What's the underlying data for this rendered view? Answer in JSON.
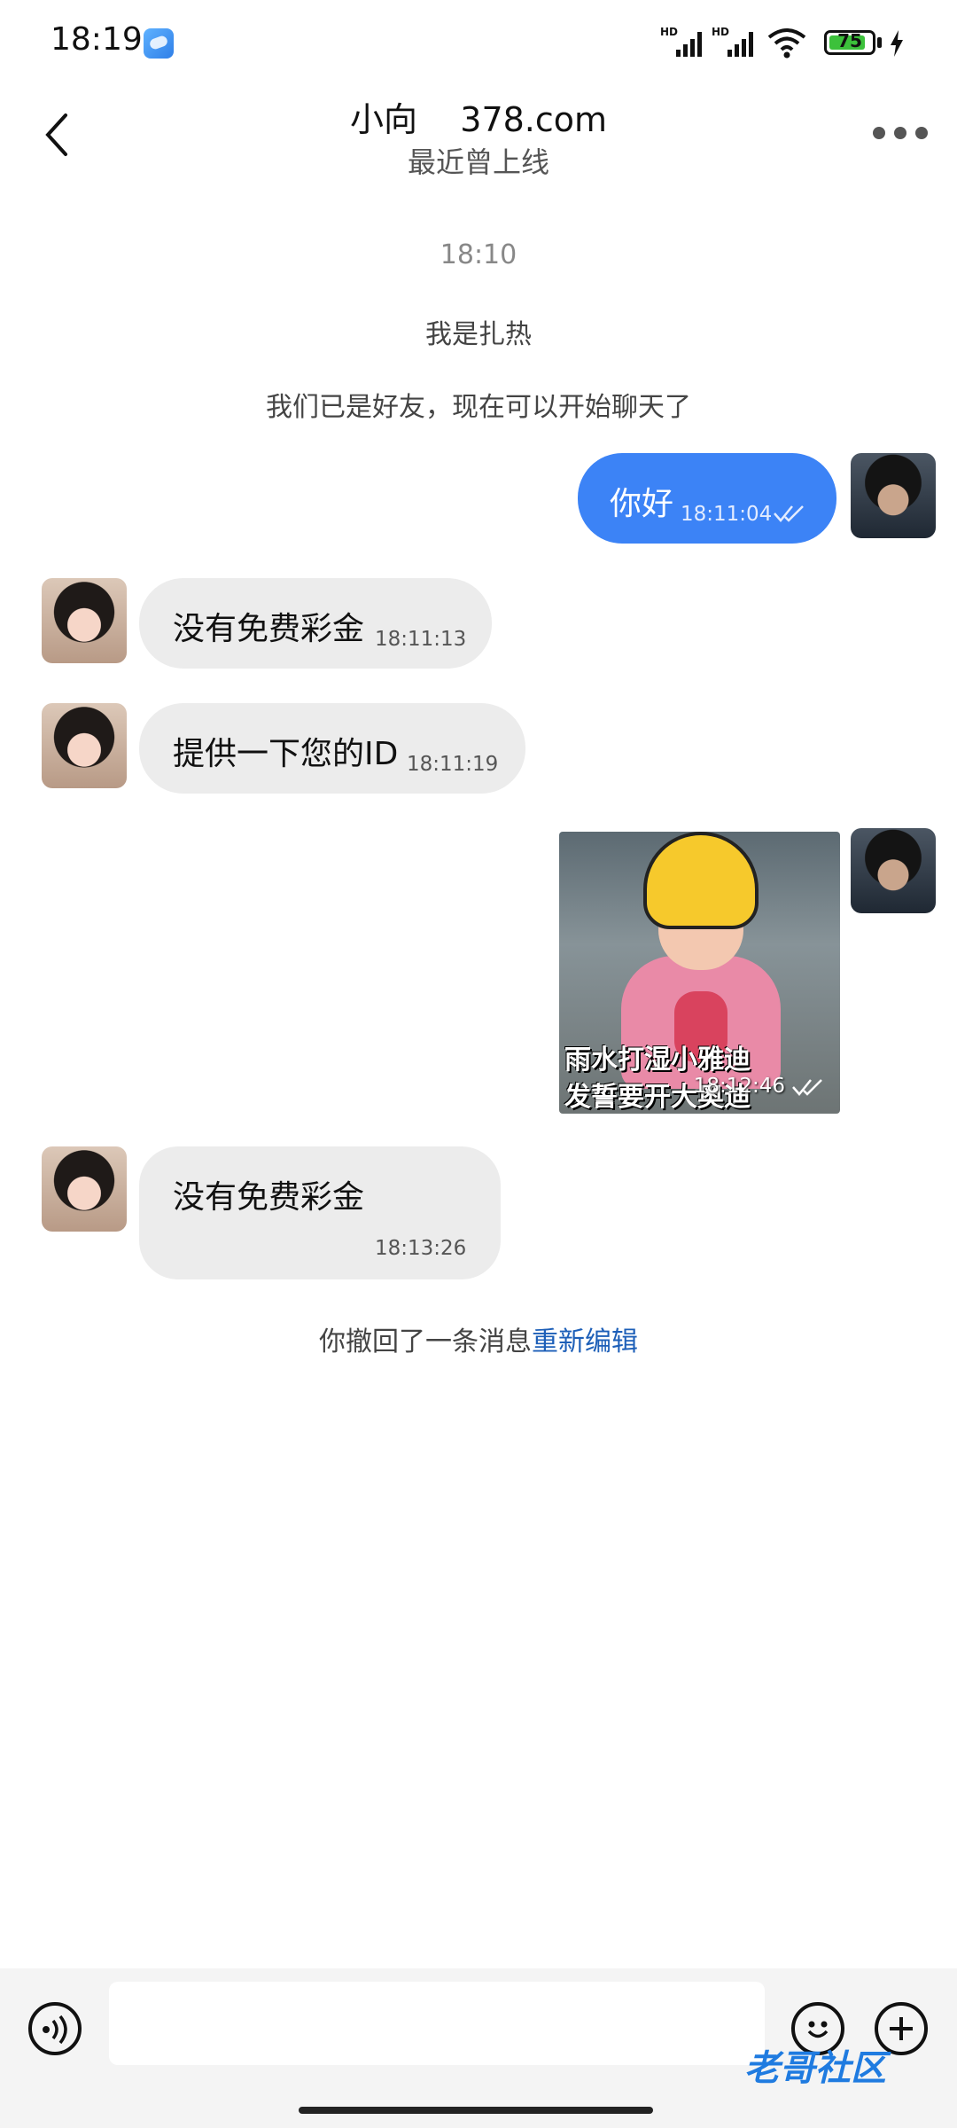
{
  "status_bar": {
    "time": "18:19",
    "battery": "75",
    "signal_label_1": "HD",
    "signal_label_2": "HD",
    "icons": [
      "app-icon",
      "signal-icon",
      "signal-icon",
      "wifi-icon",
      "battery-icon",
      "charging-icon"
    ]
  },
  "header": {
    "title": "小向    378.com",
    "status": "最近曾上线",
    "icons": [
      "back-arrow-icon",
      "more-icon"
    ]
  },
  "chat": {
    "timestamp": "18:10",
    "system_1": "我是扎热",
    "system_2": "我们已是好友，现在可以开始聊天了",
    "messages": [
      {
        "side": "out",
        "text": "你好",
        "time": "18:11:04"
      },
      {
        "side": "in",
        "text": "没有免费彩金",
        "time": "18:11:13"
      },
      {
        "side": "in",
        "text": "提供一下您的ID",
        "time": "18:11:19"
      },
      {
        "side": "out",
        "type": "image",
        "caption_1": "雨水打湿小雅迪",
        "caption_2": "发誓要开大奥迪",
        "time": "18:12:46"
      },
      {
        "side": "in",
        "text": "没有免费彩金",
        "time": "18:13:26"
      }
    ],
    "recall_notice": "你撤回了一条消息",
    "recall_edit": "重新编辑"
  },
  "input": {
    "value": "",
    "placeholder": "",
    "icons": [
      "voice-icon",
      "emoji-icon",
      "add-icon"
    ]
  },
  "watermark": "老哥社区",
  "colors": {
    "accent": "#3c83f6",
    "incoming": "#ececec",
    "link": "#1d5fb8",
    "battery": "#3cc13b"
  }
}
